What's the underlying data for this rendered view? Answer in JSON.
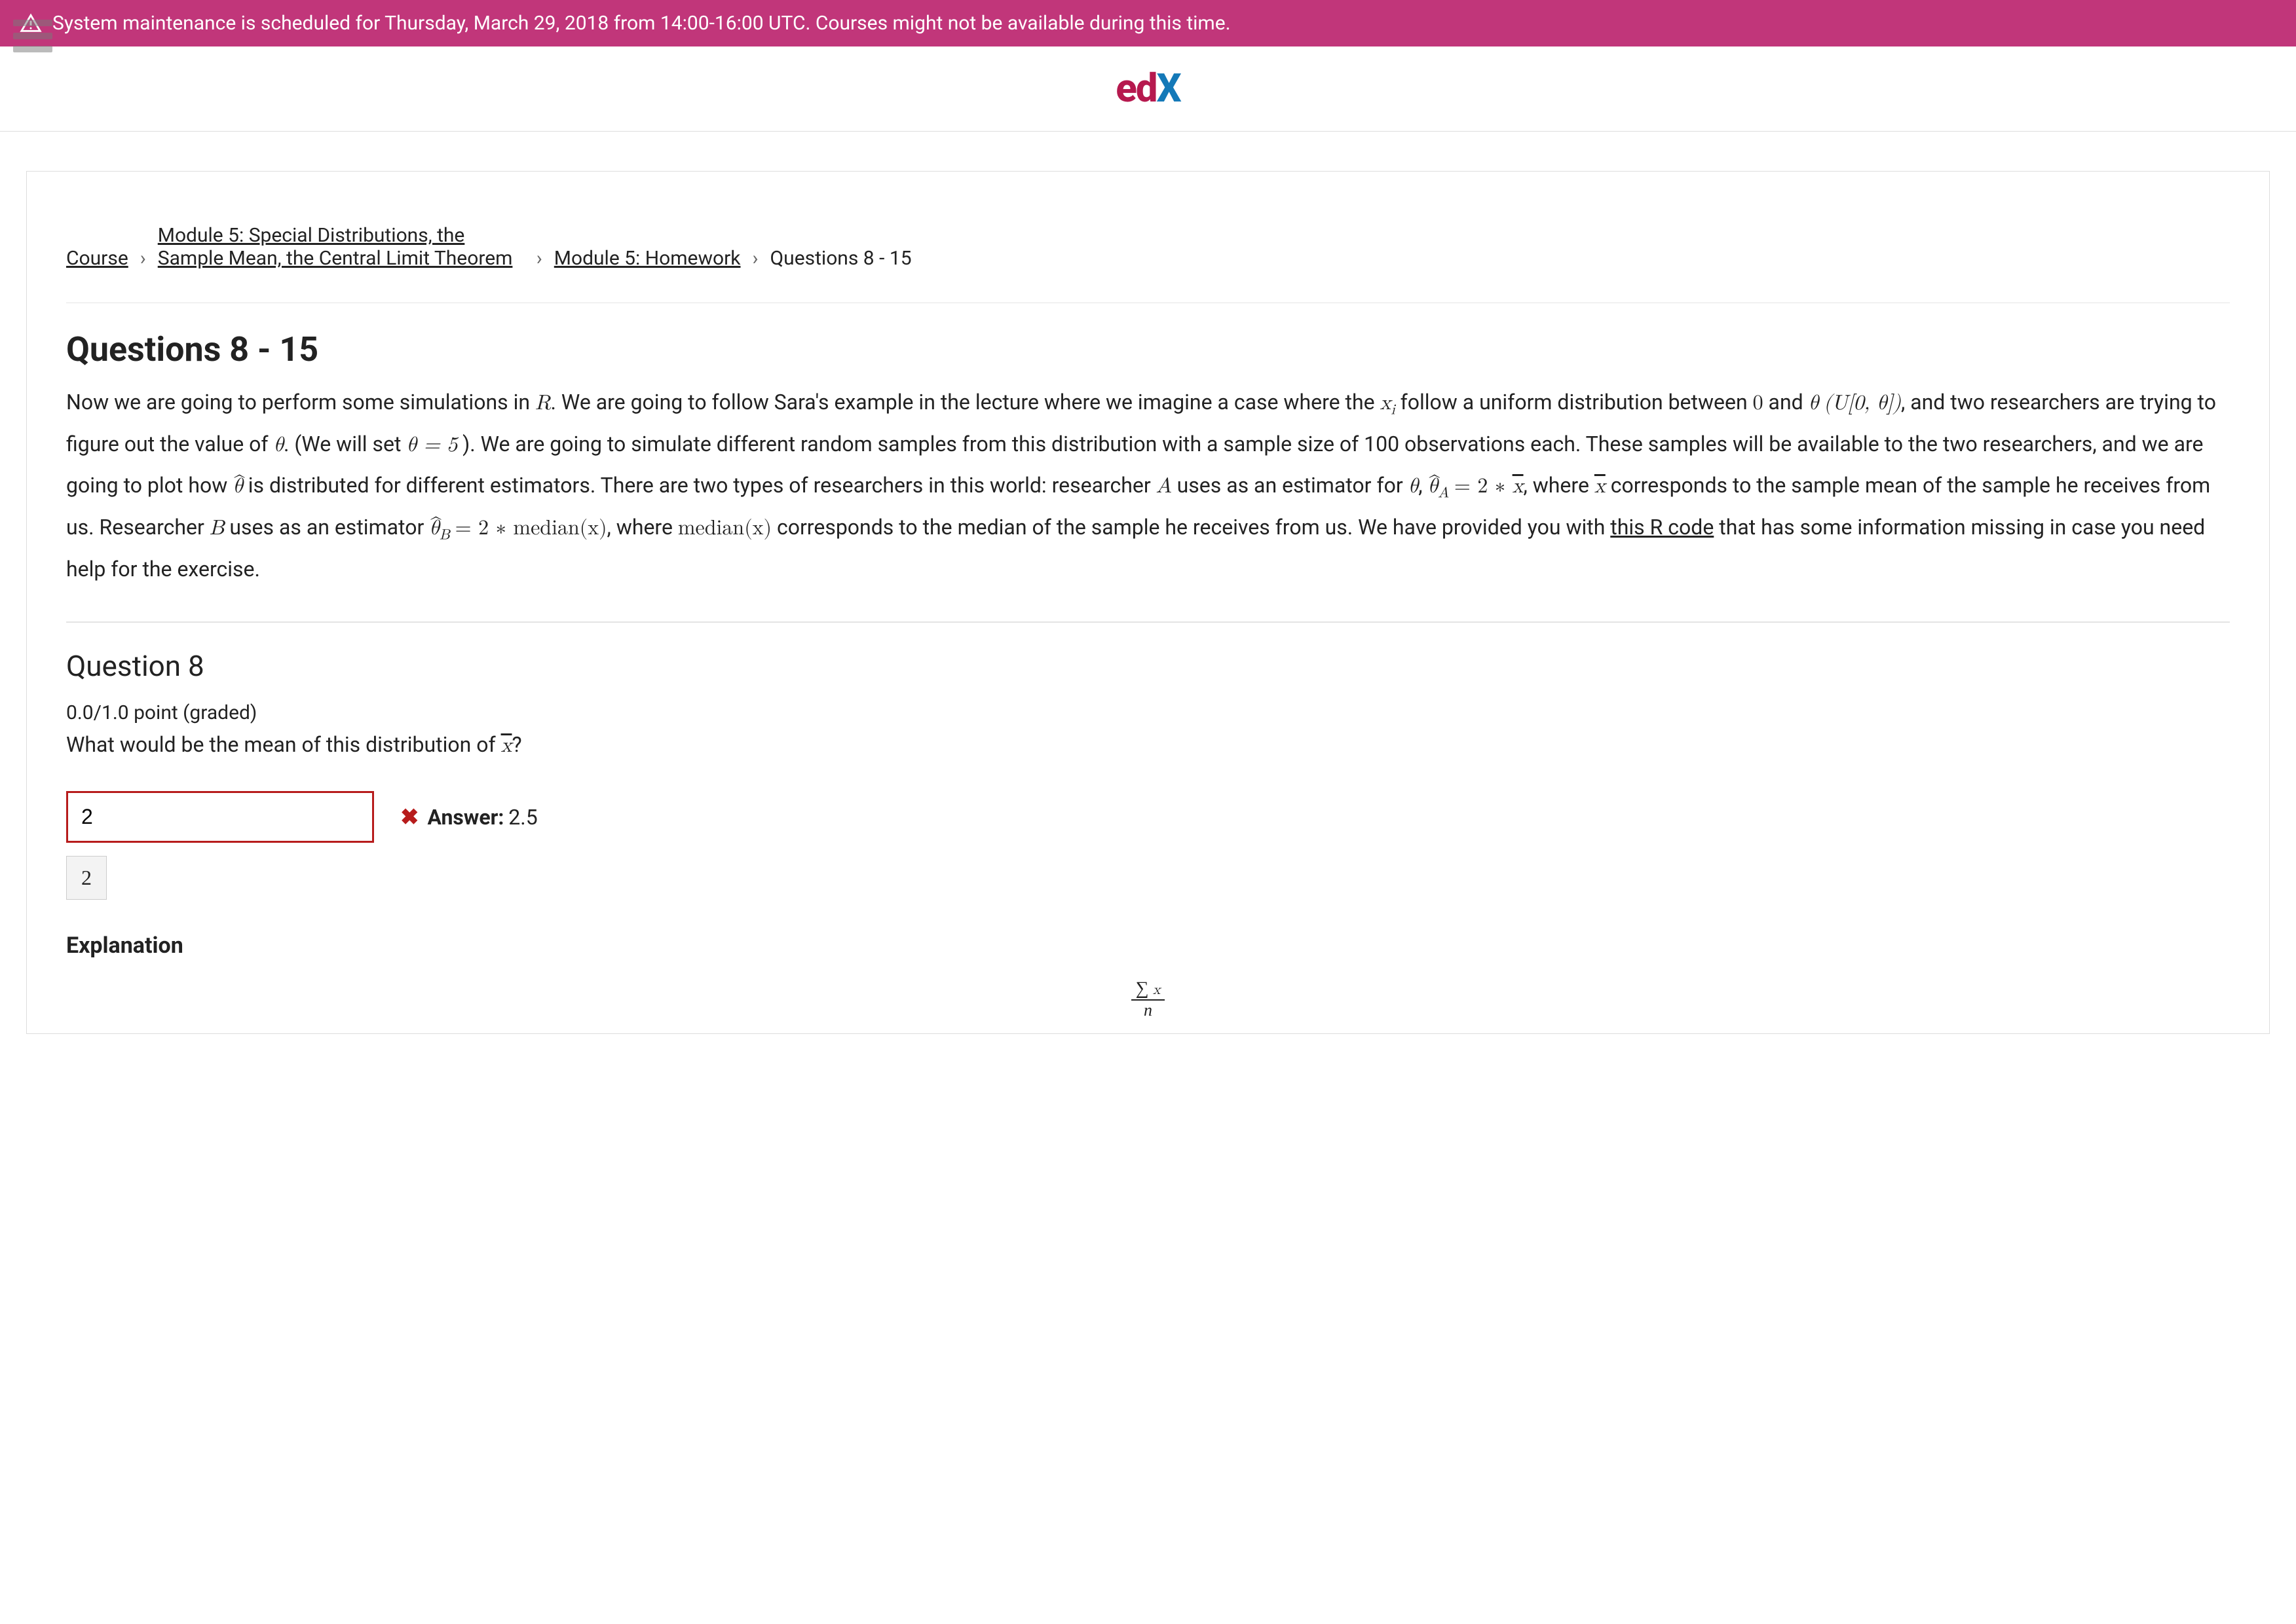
{
  "banner": {
    "text": "System maintenance is scheduled for Thursday, March 29, 2018 from 14:00-16:00 UTC. Courses might not be available during this time."
  },
  "logo": {
    "e": "e",
    "d": "d",
    "x": "X"
  },
  "breadcrumb": {
    "course": "Course",
    "module": "Module 5: Special Distributions, the Sample Mean, the Central Limit Theorem",
    "homework": "Module 5: Homework",
    "current": "Questions 8 - 15"
  },
  "pageTitle": "Questions 8 - 15",
  "intro": {
    "p1a": "Now we are going to perform some simulations in ",
    "R": "R",
    "p1b": ". We are going to follow Sara's example in the lecture where we imagine a case where the ",
    "xi": "x",
    "xi_sub": "i",
    "p1c": " follow a uniform distribution between ",
    "zero": "0",
    "and": " and ",
    "theta": "θ",
    "uopen": " (U[0, θ])",
    "p1d": ", and two researchers are trying to figure out the value of ",
    "p1e": ". (We will set ",
    "eq5": "θ = 5",
    "p1f": " ). We are going to simulate different random samples from this distribution with a sample size of 100 observations each.  These samples will be available to the two researchers, and we are going to plot how ",
    "thetahat": "θ",
    "p1g": " is distributed for different estimators.  There are two types of researchers in this world: researcher ",
    "A": "A",
    "p1h": " uses as an estimator for ",
    "thetahatA": "θ",
    "subA": "A",
    "eqA": " = 2 ∗ ",
    "xbar": "x",
    "p1i": ", where ",
    "p1j": " corresponds to the sample mean of the sample he receives from us. Researcher ",
    "B": "B",
    "p1k": " uses as an estimator ",
    "thetahatB": "θ",
    "subB": "B",
    "eqB": " = 2 ∗ median(x)",
    "p1l": ", where ",
    "medianx": "median(x)",
    "p1m": " corresponds to the median of the sample he receives from us. We have provided you with ",
    "rcode_link": "this R code",
    "p1n": " that has some information missing in case you need help for the exercise."
  },
  "q8": {
    "title": "Question 8",
    "grade": "0.0/1.0 point (graded)",
    "prompt_a": "What would be the mean of this distribution of ",
    "prompt_xbar": "x",
    "prompt_q": "?",
    "input_value": "2",
    "answer_label": "Answer:",
    "answer_value": "2.5",
    "echo": "2",
    "explanation_h": "Explanation",
    "frac_num_sigma": "∑",
    "frac_num_x": "x",
    "frac_den": "n"
  }
}
